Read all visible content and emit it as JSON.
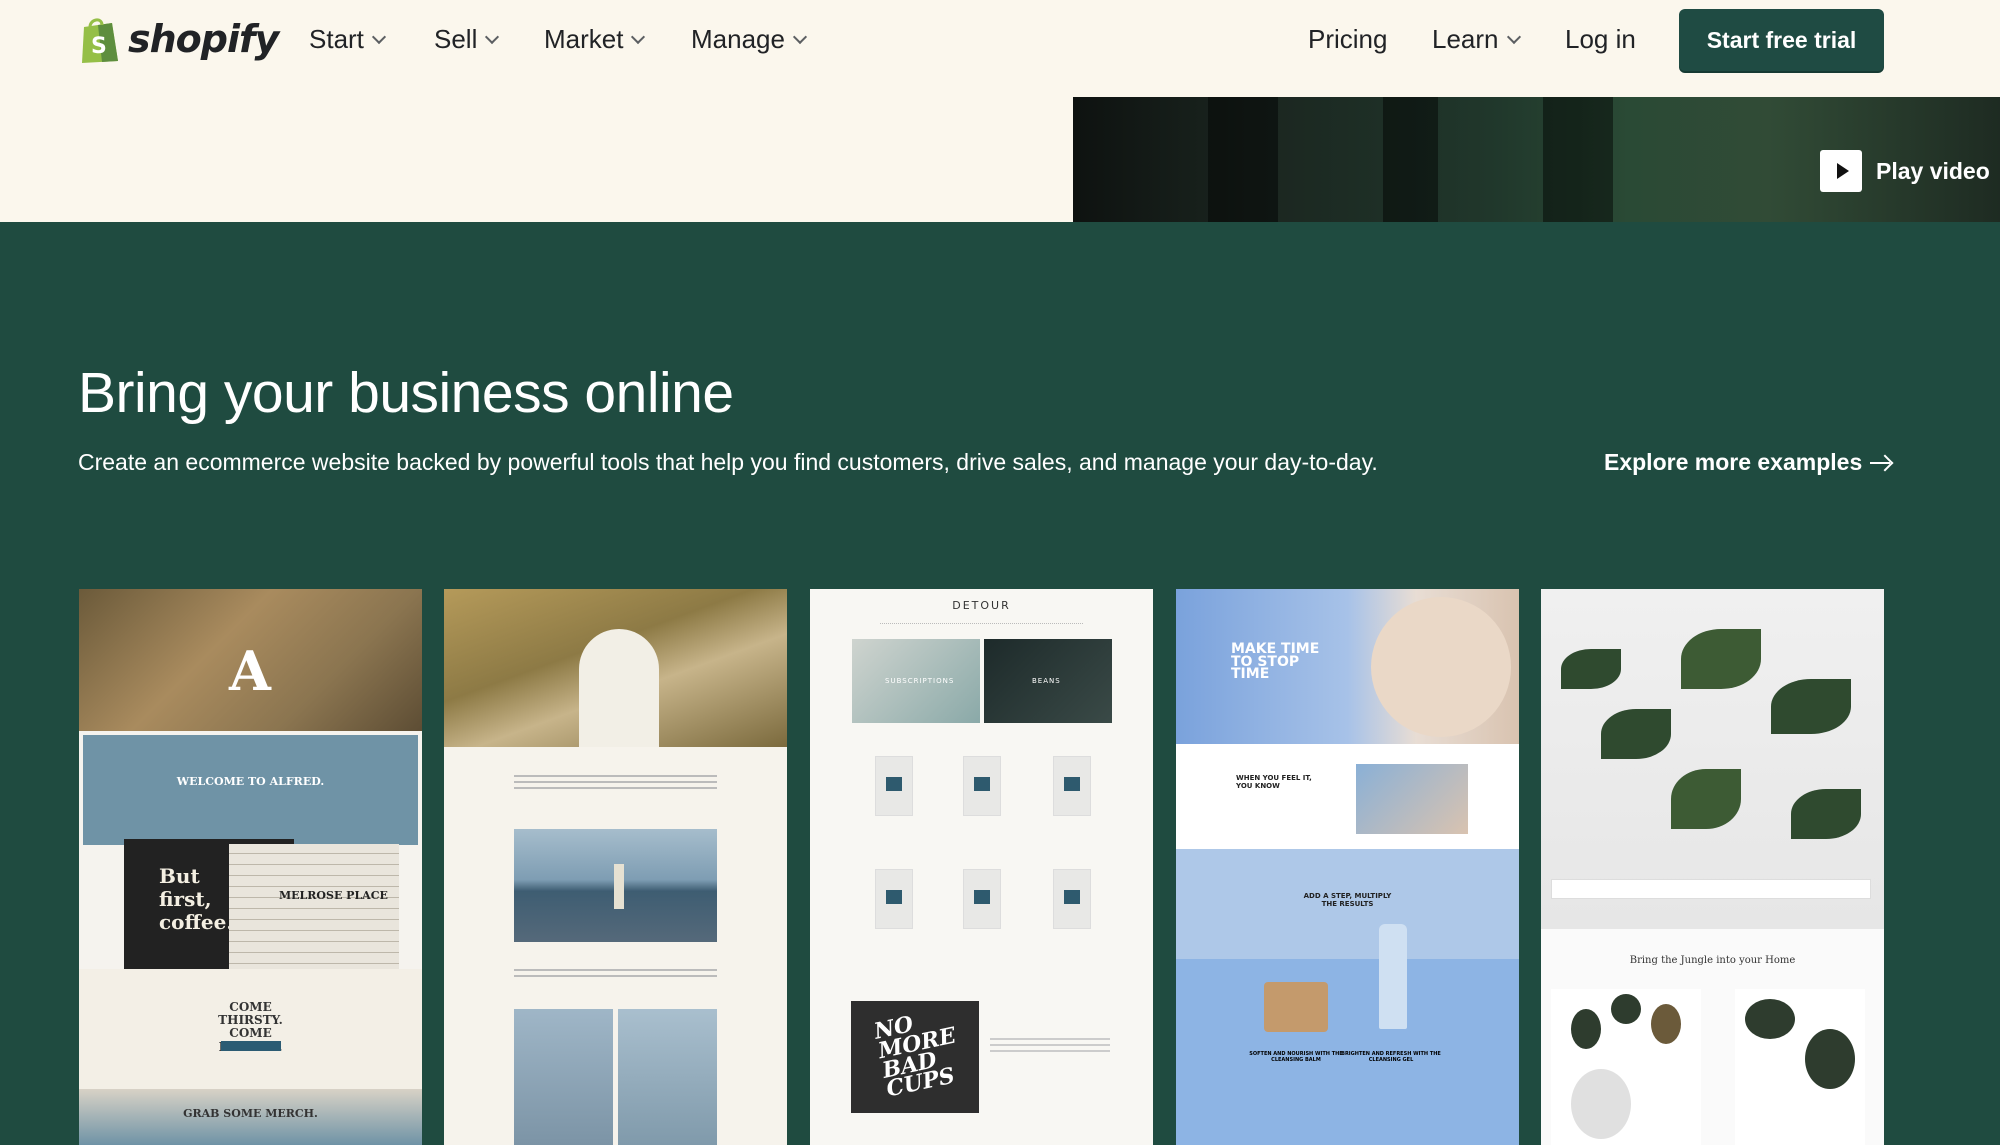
{
  "nav": {
    "logo_text": "shopify",
    "logo_letter": "S",
    "menu": [
      {
        "label": "Start"
      },
      {
        "label": "Sell"
      },
      {
        "label": "Market"
      },
      {
        "label": "Manage"
      }
    ],
    "pricing": "Pricing",
    "learn": "Learn",
    "login": "Log in",
    "cta": "Start free trial"
  },
  "hero": {
    "play_video": "Play video"
  },
  "section": {
    "headline": "Bring your business online",
    "subhead": "Create an ecommerce website backed by powerful tools that help you find customers, drive sales, and manage your day-to-day.",
    "explore": "Explore more examples"
  },
  "cards": [
    {
      "name": "alfred",
      "logo": "A",
      "welcome": "WELCOME TO ALFRED.",
      "but_first": "But first, coffee.",
      "melrose": "MELROSE PLACE",
      "thirsty": "COME THIRSTY. COME HUNGRY.",
      "merch": "GRAB SOME MERCH."
    },
    {
      "name": "outdoor-voices"
    },
    {
      "name": "detour",
      "brand": "DETOUR",
      "subscriptions": "SUBSCRIPTIONS",
      "beans": "BEANS",
      "no_more": "NO MORE BAD CUPS"
    },
    {
      "name": "skincare",
      "make_time": "MAKE TIME TO STOP TIME",
      "when_you_feel": "WHEN YOU FEEL IT, YOU KNOW",
      "add_a_step": "ADD A STEP, MULTIPLY THE RESULTS",
      "soften": "SOFTEN AND NOURISH WITH THE CLEANSING BALM",
      "brighten": "BRIGHTEN AND REFRESH WITH THE CLEANSING GEL"
    },
    {
      "name": "jungle",
      "tagline": "Bring the Jungle into your Home"
    }
  ],
  "colors": {
    "nav_bg": "#fbf7ed",
    "brand_green": "#1f4b40",
    "cta_bg": "#1f4b43",
    "text_dark": "#212326"
  },
  "icons": {
    "logo": "shopify-bag-icon",
    "dropdown": "chevron-down-icon",
    "play": "play-icon",
    "arrow": "arrow-right-icon"
  }
}
